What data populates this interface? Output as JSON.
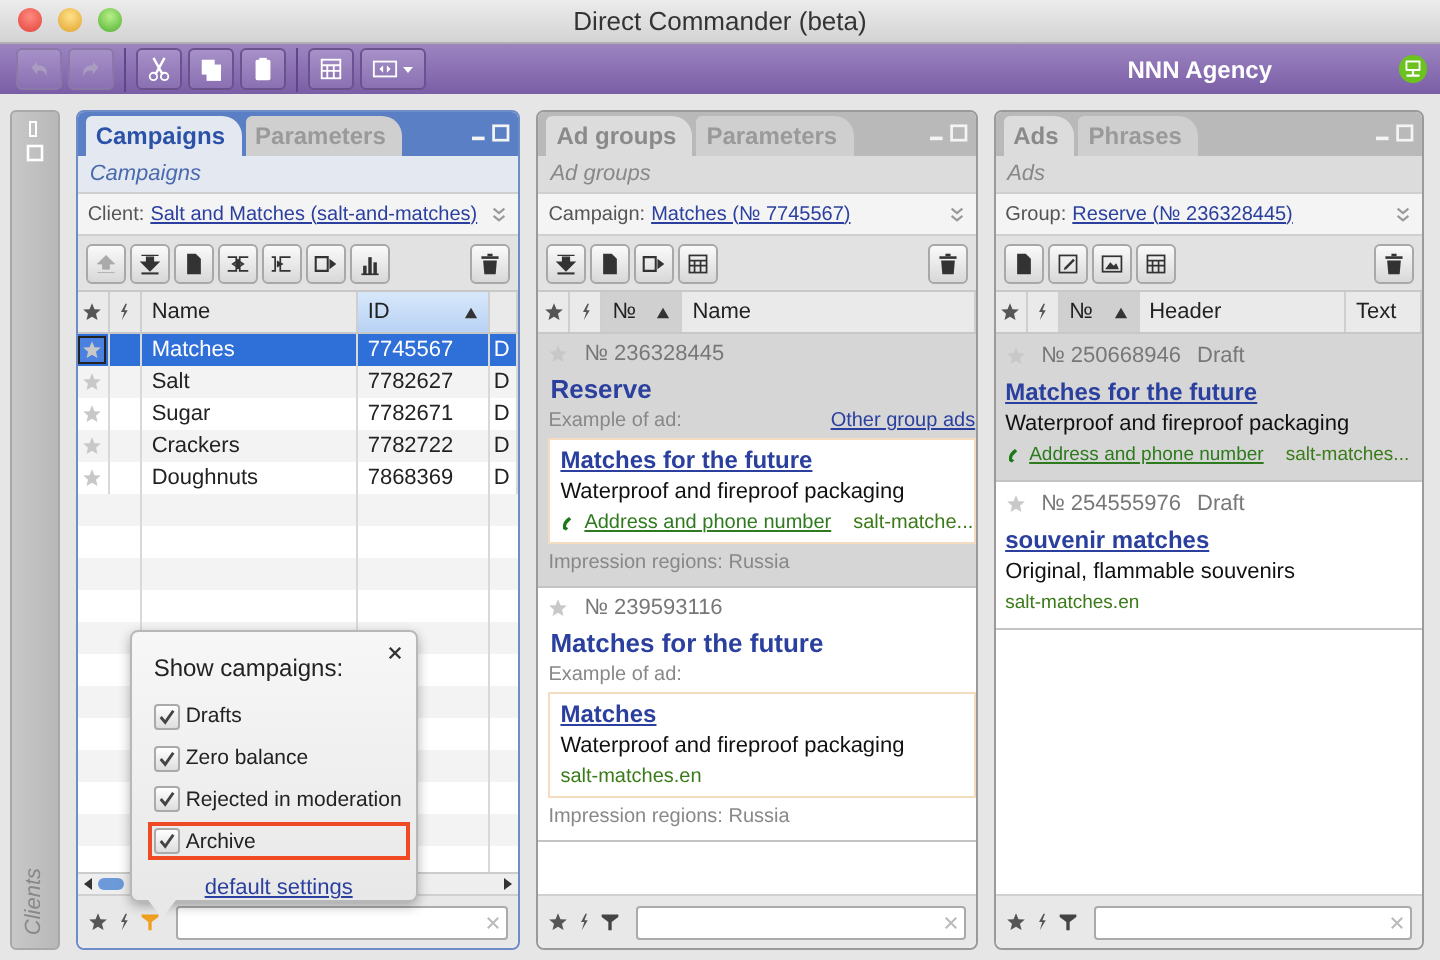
{
  "window": {
    "title": "Direct Commander (beta)"
  },
  "toolbar": {
    "buttons": [
      {
        "kind": "undo",
        "disabled": true
      },
      {
        "kind": "redo",
        "disabled": true
      },
      {
        "kind": "cut",
        "disabled": false
      },
      {
        "kind": "copy",
        "disabled": false
      },
      {
        "kind": "paste",
        "disabled": false
      },
      {
        "kind": "columns",
        "disabled": false
      },
      {
        "kind": "view",
        "disabled": false
      }
    ],
    "account": "NNN Agency"
  },
  "sidebar": {
    "label": "Clients"
  },
  "campaigns_panel": {
    "tabs": [
      {
        "label": "Campaigns",
        "selected": true
      },
      {
        "label": "Parameters",
        "selected": false
      }
    ],
    "subtitle": "Campaigns",
    "context": {
      "label": "Client:",
      "link": "Salt and Matches (salt-and-matches)"
    },
    "columns": [
      {
        "label": "Name",
        "sorted": false
      },
      {
        "label": "ID",
        "sorted": true
      }
    ],
    "rows": [
      {
        "name": "Matches",
        "id": "7745567",
        "column_3": "D",
        "selected": true
      },
      {
        "name": "Salt",
        "id": "7782627",
        "column_3": "D",
        "selected": false
      },
      {
        "name": "Sugar",
        "id": "7782671",
        "column_3": "D",
        "selected": false
      },
      {
        "name": "Crackers",
        "id": "7782722",
        "column_3": "D",
        "selected": false
      },
      {
        "name": "Doughnuts",
        "id": "7868369",
        "column_3": "D",
        "selected": false
      }
    ],
    "popup": {
      "title": "Show campaigns:",
      "options": [
        {
          "label": "Drafts",
          "checked": true,
          "highlighted": false
        },
        {
          "label": "Zero balance",
          "checked": true,
          "highlighted": false
        },
        {
          "label": "Rejected in moderation",
          "checked": true,
          "highlighted": false
        },
        {
          "label": "Archive",
          "checked": true,
          "highlighted": true
        }
      ],
      "link": "default settings"
    }
  },
  "ad_groups_panel": {
    "tabs": [
      {
        "label": "Ad groups",
        "selected": true
      },
      {
        "label": "Parameters",
        "selected": false
      }
    ],
    "subtitle": "Ad groups",
    "context": {
      "label": "Campaign:",
      "link": "Matches (№ 7745567)"
    },
    "columns": [
      {
        "label": "№",
        "sorted": true
      },
      {
        "label": "Name",
        "sorted": false
      }
    ],
    "groups": [
      {
        "number": "№ 236328445",
        "name": "Reserve",
        "selected": true,
        "example_label": "Example of ad:",
        "other_link": "Other group ads",
        "ad": {
          "title": "Matches for the future",
          "text": "Waterproof and fireproof packaging",
          "contact": "Address and phone number",
          "domain": "salt-matche..."
        },
        "regions": "Impression regions: Russia"
      },
      {
        "number": "№ 239593116",
        "name": "Matches for the future",
        "selected": false,
        "example_label": "Example of ad:",
        "ad": {
          "title": "Matches",
          "text": "Waterproof and fireproof packaging",
          "domain": "salt-matches.en"
        },
        "regions": "Impression regions: Russia"
      }
    ]
  },
  "ads_panel": {
    "tabs": [
      {
        "label": "Ads",
        "selected": true
      },
      {
        "label": "Phrases",
        "selected": false
      }
    ],
    "subtitle": "Ads",
    "context": {
      "label": "Group:",
      "link": "Reserve (№ 236328445)"
    },
    "columns": [
      {
        "label": "№",
        "sorted": true
      },
      {
        "label": "Header",
        "sorted": false
      },
      {
        "label": "Text",
        "sorted": false
      }
    ],
    "ads": [
      {
        "number": "№ 250668946",
        "status": "Draft",
        "title": "Matches for the future",
        "text": "Waterproof and fireproof packaging",
        "contact": "Address and phone number",
        "domain": "salt-matches...",
        "selected": true
      },
      {
        "number": "№ 254555976",
        "status": "Draft",
        "title": "souvenir matches",
        "text": "Original, flammable souvenirs",
        "domain": "salt-matches.en",
        "selected": false
      }
    ]
  }
}
